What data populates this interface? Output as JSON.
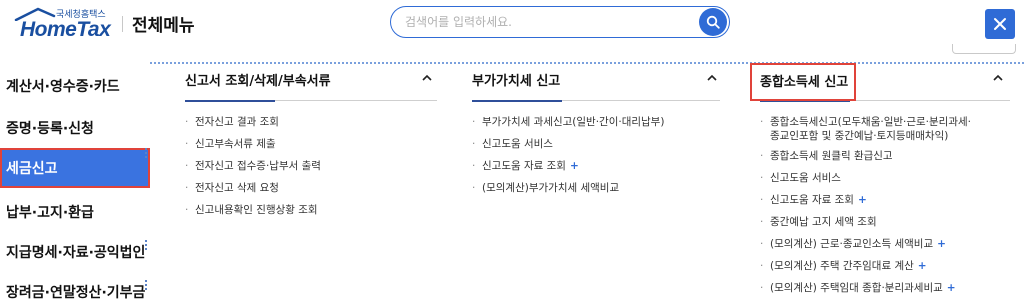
{
  "header": {
    "logo_sub": "국세청홈택스",
    "logo_main": "HomeTax",
    "menu_title": "전체메뉴",
    "search_placeholder": "검색어를 입력하세요."
  },
  "sidebar": {
    "items": [
      {
        "label": "계산서·영수증·카드",
        "active": false
      },
      {
        "label": "증명·등록·신청",
        "active": false
      },
      {
        "label": "세금신고",
        "active": true
      },
      {
        "label": "납부·고지·환급",
        "active": false
      },
      {
        "label": "지급명세·자료·공익법인",
        "active": false
      },
      {
        "label": "장려금·연말정산·기부금",
        "active": false
      }
    ]
  },
  "columns": [
    {
      "title": "신고서 조회/삭제/부속서류",
      "items": [
        {
          "label": "전자신고 결과 조회",
          "plus": false
        },
        {
          "label": "신고부속서류 제출",
          "plus": false
        },
        {
          "label": "전자신고 접수증·납부서 출력",
          "plus": false
        },
        {
          "label": "전자신고 삭제 요청",
          "plus": false
        },
        {
          "label": "신고내용확인 진행상황 조회",
          "plus": false
        }
      ]
    },
    {
      "title": "부가가치세 신고",
      "items": [
        {
          "label": "부가가치세 과세신고(일반·간이·대리납부)",
          "plus": false
        },
        {
          "label": "신고도움 서비스",
          "plus": false
        },
        {
          "label": "신고도움 자료 조회",
          "plus": true
        },
        {
          "label": "(모의계산)부가가치세 세액비교",
          "plus": false
        }
      ]
    },
    {
      "title": "종합소득세 신고",
      "items": [
        {
          "label": "종합소득세신고(모두채움·일반·근로·분리과세·",
          "label2": "종교인포함 및 중간예납·토지등매매차익)",
          "plus": false
        },
        {
          "label": "종합소득세 원클릭 환급신고",
          "plus": false
        },
        {
          "label": "신고도움 서비스",
          "plus": false
        },
        {
          "label": "신고도움 자료 조회",
          "plus": true
        },
        {
          "label": "중간예납 고지 세액 조회",
          "plus": false
        },
        {
          "label": "(모의계산) 근로·종교인소득 세액비교",
          "plus": true
        },
        {
          "label": "(모의계산) 주택 간주임대료 계산",
          "plus": true
        },
        {
          "label": "(모의계산) 주택임대 종합·분리과세비교",
          "plus": true
        }
      ]
    }
  ],
  "icons": {
    "search": "search-icon",
    "close": "close-icon",
    "collapse": "chevron-up-icon"
  },
  "colors": {
    "accent": "#2f6bd6",
    "active_bg": "#3a73e0",
    "highlight": "#e0433a",
    "brand": "#1a4fa0"
  }
}
